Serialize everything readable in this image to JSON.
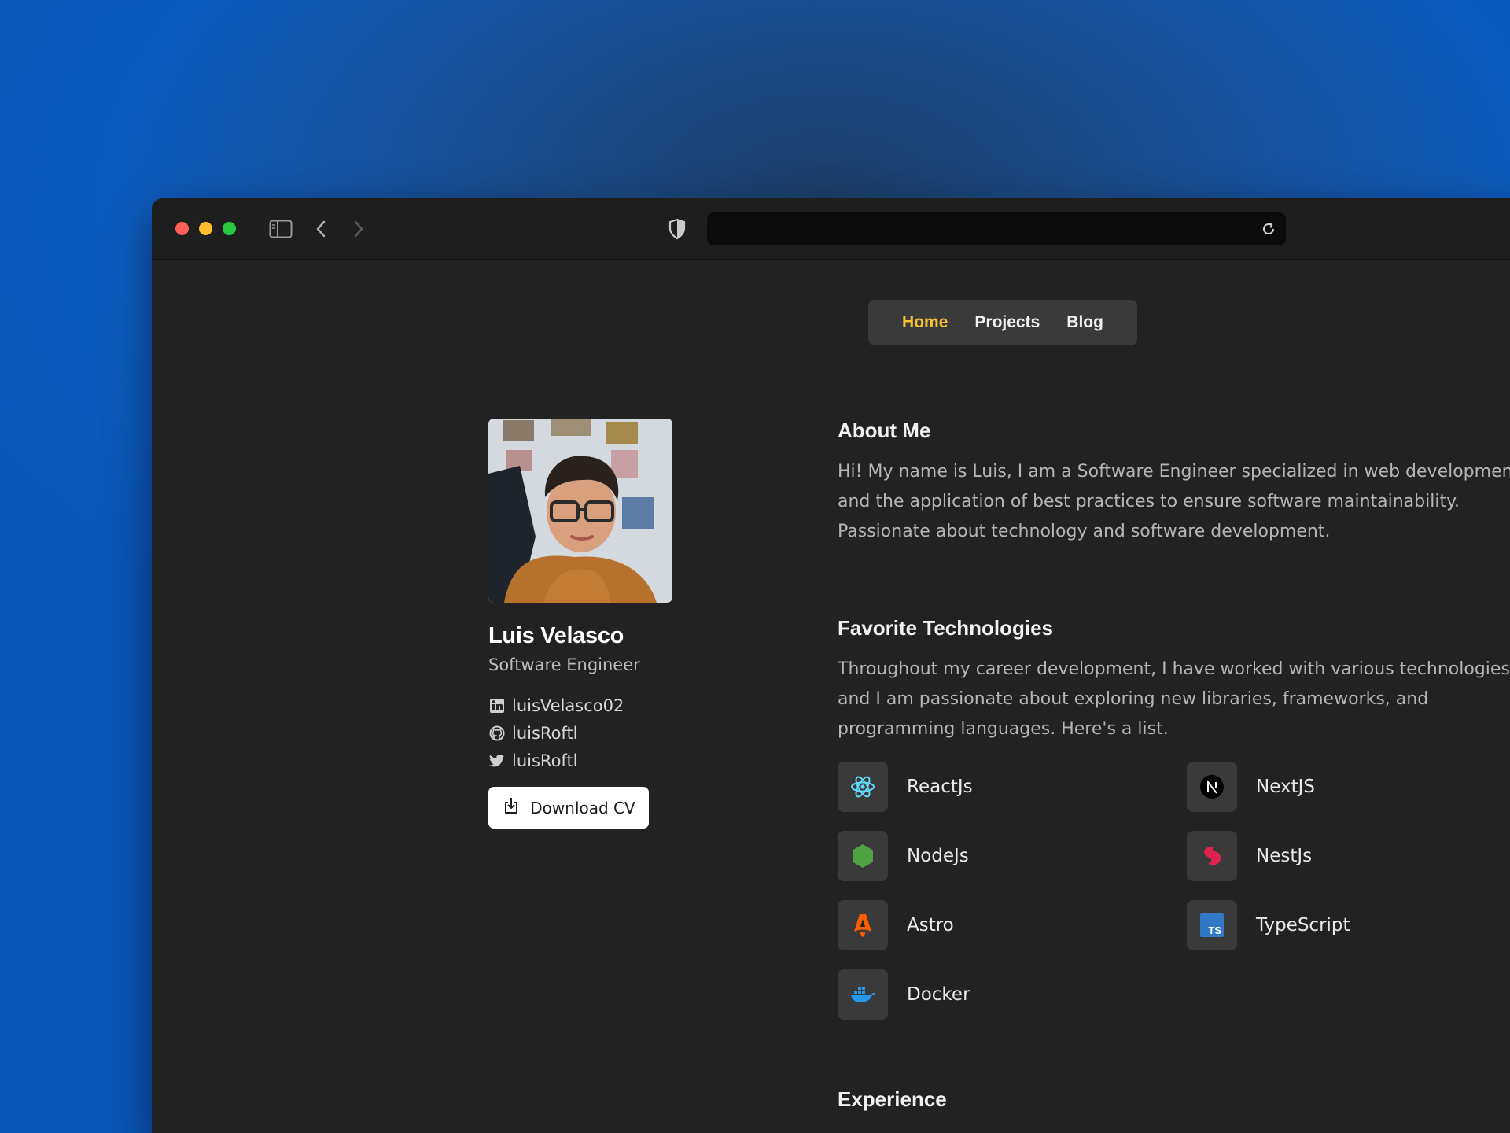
{
  "nav": {
    "home": "Home",
    "projects": "Projects",
    "blog": "Blog"
  },
  "profile": {
    "name": "Luis Velasco",
    "role": "Software Engineer",
    "socials": [
      {
        "icon": "linkedin-icon",
        "handle": "luisVelasco02"
      },
      {
        "icon": "github-icon",
        "handle": "luisRoftl"
      },
      {
        "icon": "twitter-icon",
        "handle": "luisRoftl"
      }
    ],
    "cv_button": "Download CV"
  },
  "about": {
    "title": "About Me",
    "text": "Hi! My name is Luis, I am a Software Engineer specialized in web development and the application of best practices to ensure software maintainability. Passionate about technology and software development."
  },
  "technologies": {
    "title": "Favorite Technologies",
    "text": "Throughout my career development, I have worked with various technologies, and I am passionate about exploring new libraries, frameworks, and programming languages. Here's a list.",
    "items": [
      "ReactJs",
      "NextJS",
      "NodeJs",
      "NestJs",
      "Astro",
      "TypeScript",
      "Docker"
    ]
  },
  "experience": {
    "title": "Experience"
  },
  "colors": {
    "accent": "#f5c033",
    "background": "#222222"
  }
}
